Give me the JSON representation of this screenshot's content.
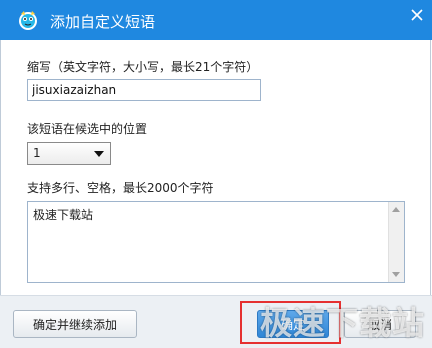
{
  "dialog": {
    "title": "添加自定义短语",
    "title_icon": "app-logo-icon",
    "close_icon": "close-icon"
  },
  "form": {
    "abbr_label": "缩写（英文字符，大小写，最长21个字符）",
    "abbr_value": "jisuxiazaizhan",
    "position_label": "该短语在候选中的位置",
    "position_value": "1",
    "content_label": "支持多行、空格，最长2000个字符",
    "content_value": "极速下载站"
  },
  "footer": {
    "continue_label": "确定并继续添加",
    "ok_label": "确定",
    "cancel_label": "取消"
  },
  "watermark": {
    "text": "极速下载站"
  },
  "colors": {
    "titlebar": "#1f88e0",
    "footer_bg": "#ecf0f4",
    "highlight": "#e53030",
    "ok_button": "#2f86d6"
  }
}
